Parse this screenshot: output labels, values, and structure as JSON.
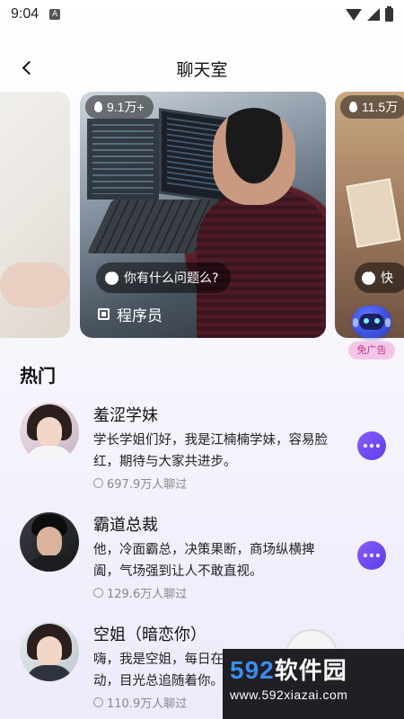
{
  "status_bar": {
    "time": "9:04",
    "a_label": "A"
  },
  "header": {
    "title": "聊天室"
  },
  "carousel": {
    "cards": [
      {
        "heat": "9.1万+",
        "prompt": "你有什么问题么?",
        "name": "程序员"
      },
      {
        "heat": "11.5万",
        "prompt": "快"
      }
    ]
  },
  "robot": {
    "label": "免广告"
  },
  "section": {
    "title": "热门"
  },
  "items": [
    {
      "name": "羞涩学妹",
      "desc": "学长学姐们好，我是江楠楠学妹，容易脸红，期待与大家共进步。",
      "count": "697.9万人聊过"
    },
    {
      "name": "霸道总裁",
      "desc": "他，冷面霸总，决策果断，商场纵横捭阖，气场强到让人不敢直视。",
      "count": "129.6万人聊过"
    },
    {
      "name": "空姐（暗恋你）",
      "desc": "嗨，我是空姐，每日在云端遇见你，悄心动，目光总追随着你。",
      "count": "110.9万人聊过"
    }
  ],
  "watermark": {
    "brand_num": "592",
    "brand_text": "软件园",
    "url": "www.592xiazai.com"
  }
}
